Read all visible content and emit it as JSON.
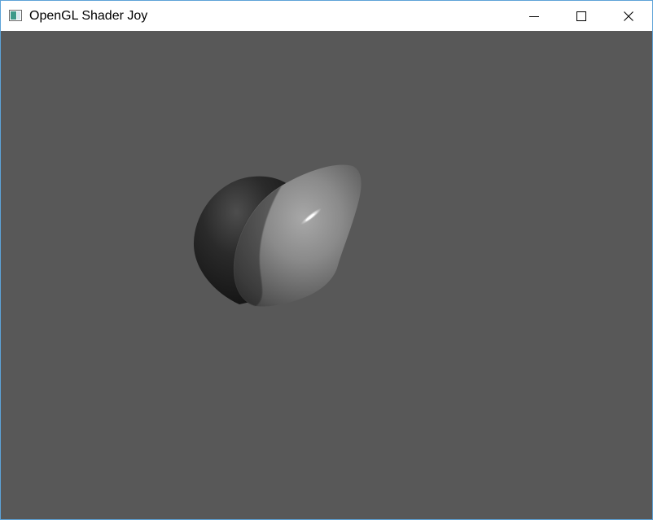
{
  "window": {
    "title": "OpenGL Shader Joy",
    "app_icon": "window-icon",
    "controls": [
      {
        "name": "minimize",
        "icon": "minimize-icon"
      },
      {
        "name": "maximize",
        "icon": "maximize-icon"
      },
      {
        "name": "close",
        "icon": "close-icon"
      }
    ]
  },
  "viewport": {
    "background_color": "#585858",
    "object": "shaded-3d-blob"
  }
}
